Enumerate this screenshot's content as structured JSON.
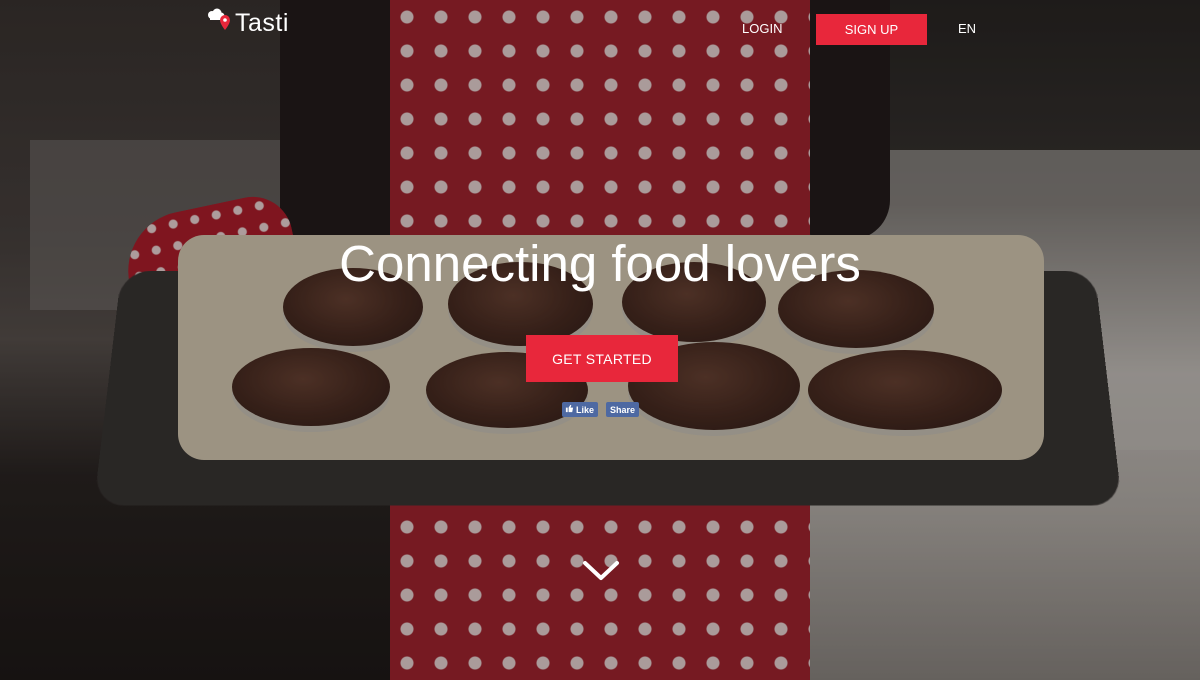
{
  "brand": {
    "name": "Tasti",
    "accent_color": "#e8273b"
  },
  "nav": {
    "login": "LOGIN",
    "signup": "SIGN UP",
    "language": "EN"
  },
  "hero": {
    "title": "Connecting food lovers",
    "cta": "GET STARTED"
  },
  "social": {
    "like": "Like",
    "share": "Share",
    "facebook_color": "#4e69a2"
  },
  "icons": {
    "logo": "chef-hat-location-pin-icon",
    "scroll": "chevron-down-icon",
    "like": "thumbs-up-icon"
  }
}
